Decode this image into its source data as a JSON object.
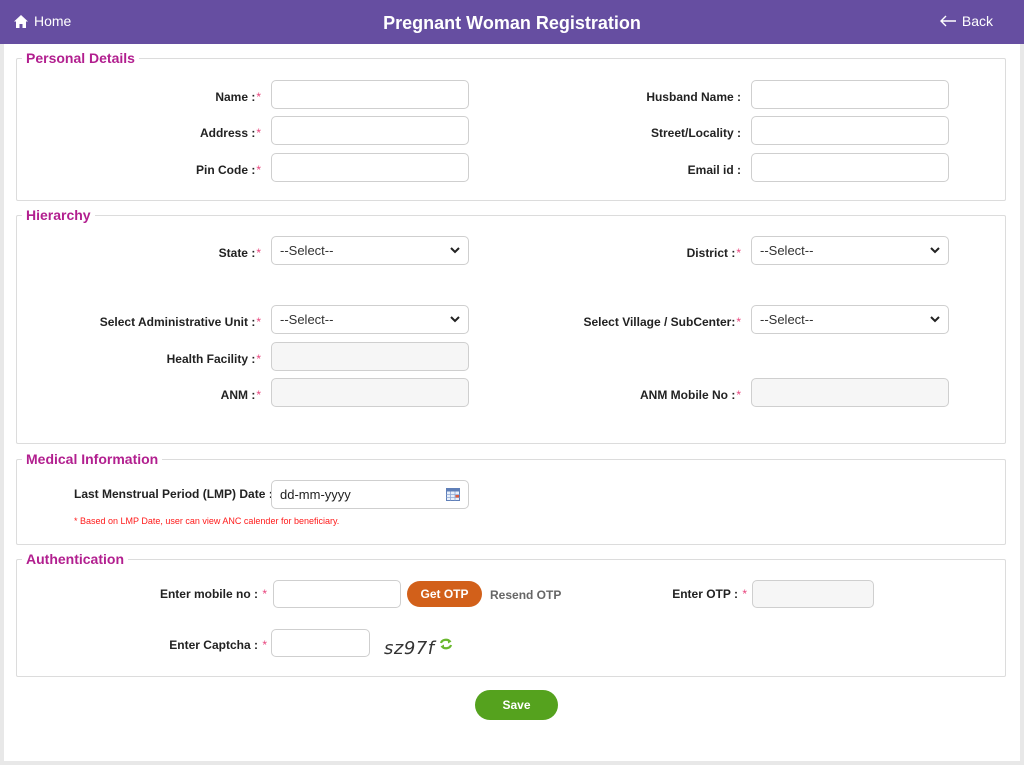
{
  "header": {
    "title": "Pregnant Woman Registration",
    "home_label": "Home",
    "back_label": "Back",
    "bar_color": "#664ea1"
  },
  "sections": {
    "personal": {
      "legend": "Personal Details",
      "name_label": "Name :",
      "address_label": "Address :",
      "pincode_label": "Pin Code :",
      "husband_label": "Husband Name :",
      "street_label": "Street/Locality :",
      "email_label": "Email id :",
      "name_value": "",
      "address_value": "",
      "pincode_value": "",
      "husband_value": "",
      "street_value": "",
      "email_value": ""
    },
    "hierarchy": {
      "legend": "Hierarchy",
      "state_label": "State :",
      "district_label": "District :",
      "admin_unit_label": "Select Administrative Unit :",
      "village_label": "Select Village / SubCenter:",
      "health_facility_label": "Health Facility :",
      "anm_label": "ANM :",
      "anm_mobile_label": "ANM Mobile No :",
      "state_selected": "--Select--",
      "district_selected": "--Select--",
      "admin_unit_selected": "--Select--",
      "village_selected": "--Select--"
    },
    "medical": {
      "legend": "Medical Information",
      "lmp_label": "Last Menstrual Period (LMP) Date :",
      "lmp_placeholder": "dd-mm-yyyy",
      "note": "* Based on LMP Date, user can view ANC calender for beneficiary."
    },
    "auth": {
      "legend": "Authentication",
      "mobile_label": "Enter mobile no :",
      "get_otp": "Get OTP",
      "resend_otp": "Resend OTP",
      "otp_label": "Enter OTP :",
      "captcha_label": "Enter Captcha :",
      "captcha_text": "sz97f"
    }
  },
  "required_marker": "*",
  "save_label": "Save",
  "colors": {
    "legend": "#b21f8f",
    "required": "#e8457d",
    "get_otp": "#d2601a",
    "save": "#55a21e",
    "note": "#ff1a1a"
  }
}
